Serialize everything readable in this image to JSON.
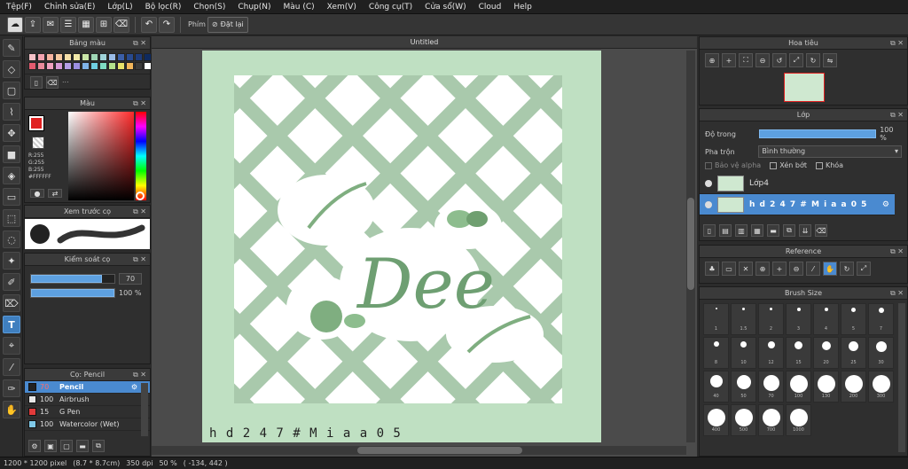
{
  "menu": [
    "Tệp(F)",
    "Chỉnh sửa(E)",
    "Lớp(L)",
    "Bộ lọc(R)",
    "Chọn(S)",
    "Chụp(N)",
    "Màu (C)",
    "Xem(V)",
    "Công cụ(T)",
    "Cửa sổ(W)",
    "Cloud",
    "Help"
  ],
  "toolbar": {
    "snap_label": "Phím",
    "reset_label": "Đặt lại"
  },
  "palette_panel": {
    "title": "Bảng màu",
    "swatches": [
      "#f6c2c8",
      "#f4a3b0",
      "#f7b4a0",
      "#f6c9a0",
      "#f5dfa8",
      "#f1e9a9",
      "#c9e6a8",
      "#9fd6b5",
      "#9fd3d9",
      "#9bbde8",
      "#3b5fa8",
      "#284a8f",
      "#1e3b7a",
      "#0f2a5e",
      "#e35b6f",
      "#e98a9b",
      "#f0a1c0",
      "#d69ad8",
      "#b59ee6",
      "#9b8ee0",
      "#7fb3e8",
      "#6fcfe2",
      "#7fdcc1",
      "#b3e28b",
      "#e8e26a",
      "#f2b65a",
      "#3a3a3a",
      "#ffffff"
    ],
    "extra": "..."
  },
  "color_panel": {
    "title": "Màu",
    "r": "R:255",
    "g": "G:255",
    "b": "B:255",
    "hex": "#FFFFFF",
    "main_color": "#e02020",
    "sub_color": "#ffffff"
  },
  "preview_panel": {
    "title": "Xem trước cọ"
  },
  "brush_control": {
    "title": "Kiểm soát cọ",
    "size_value": "70",
    "opacity_value": "100 %",
    "size_fraction": 0.85,
    "opacity_fraction": 1.0
  },
  "brush_list": {
    "title": "Cọ: Pencil",
    "items": [
      {
        "size": "70",
        "name": "Pencil",
        "color": "#222222"
      },
      {
        "size": "100",
        "name": "Airbrush",
        "color": "#e8e8e8"
      },
      {
        "size": "15",
        "name": "G Pen",
        "color": "#e03a3a"
      },
      {
        "size": "100",
        "name": "Watercolor (Wet)",
        "color": "#7fc9e8"
      }
    ]
  },
  "canvas": {
    "tab_title": "Untitled",
    "signature": "h d 2 4 7 # M i a a 0 5"
  },
  "status": {
    "size": "1200 * 1200 pixel",
    "cm": "(8.7 * 8.7cm)",
    "dpi": "350 dpi",
    "zoom": "50 %",
    "coords": "( -134, 442 )"
  },
  "navigator": {
    "title": "Hoa tiêu"
  },
  "layer_panel": {
    "title": "Lớp",
    "opacity_label": "Độ trong",
    "opacity_value": "100 %",
    "blend_label": "Pha trộn",
    "blend_value": "Bình thường",
    "protect_alpha": "Bảo vệ alpha",
    "clipping": "Xén bớt",
    "lock": "Khóa",
    "layers": [
      {
        "name": "Lớp4",
        "selected": false
      },
      {
        "name": "h d 2 4 7 # M i a a 0 5",
        "selected": true
      }
    ]
  },
  "reference_panel": {
    "title": "Reference"
  },
  "brush_size_panel": {
    "title": "Brush Size",
    "sizes": [
      "1",
      "1.5",
      "2",
      "3",
      "4",
      "5",
      "7",
      "8",
      "10",
      "12",
      "15",
      "20",
      "25",
      "30",
      "40",
      "50",
      "70",
      "100",
      "130",
      "200",
      "300",
      "400",
      "500",
      "700",
      "1000"
    ]
  }
}
